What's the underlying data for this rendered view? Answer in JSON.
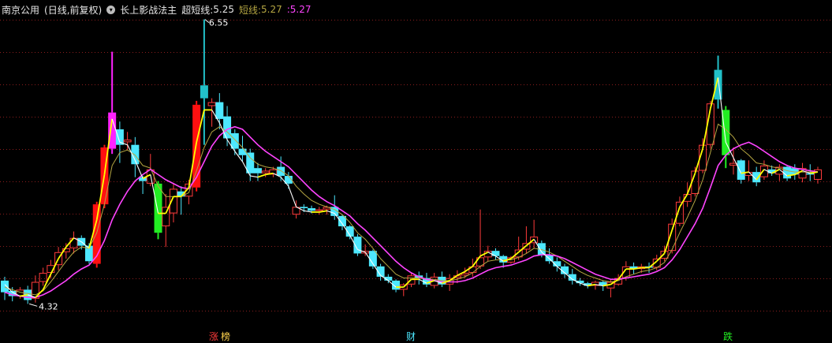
{
  "header": {
    "stock": "南京公用",
    "mode": "(日线,前复权)",
    "indicator_name": "长上影战法主",
    "line1_label": "超短线:",
    "line1_value": "5.25",
    "line2_label": "短线:",
    "line2_value": "5.27",
    "line3_label": ":",
    "line3_value": "5.27",
    "dropdown_icon": "chevron-down-icon"
  },
  "colors": {
    "up": "#ff3b3b",
    "down": "#4de8ff",
    "grid": "#8a1d1d",
    "signal_magenta": "#ff22ff",
    "signal_cyan": "#22c0c8",
    "signal_red": "#ff1010",
    "signal_green": "#22ee22",
    "line_fast": "#ffff00",
    "line_white": "#ffffff",
    "line_olive": "#b5a642",
    "line_ma": "#ff44ff"
  },
  "chart_data": {
    "type": "candlestick",
    "ylim": [
      4.2,
      6.7
    ],
    "annotations": {
      "high_label": "6.55",
      "low_label": "4.32"
    },
    "markers": [
      "涨",
      "榜",
      "财",
      "跌"
    ],
    "candles": [
      [
        4.53,
        4.44,
        4.56,
        4.38
      ],
      [
        4.45,
        4.41,
        4.48,
        4.37
      ],
      [
        4.41,
        4.46,
        4.48,
        4.39
      ],
      [
        4.46,
        4.38,
        4.49,
        4.35
      ],
      [
        4.39,
        4.52,
        4.57,
        4.36
      ],
      [
        4.52,
        4.59,
        4.63,
        4.49
      ],
      [
        4.59,
        4.65,
        4.69,
        4.55
      ],
      [
        4.65,
        4.75,
        4.79,
        4.61
      ],
      [
        4.75,
        4.78,
        4.82,
        4.7
      ],
      [
        4.78,
        4.86,
        4.91,
        4.74
      ],
      [
        4.86,
        4.8,
        4.88,
        4.77
      ],
      [
        4.8,
        4.68,
        4.82,
        4.66
      ],
      [
        4.66,
        5.12,
        5.14,
        4.63
      ],
      [
        5.12,
        5.56,
        5.58,
        5.09
      ],
      [
        5.55,
        5.83,
        6.3,
        5.51
      ],
      [
        5.7,
        5.58,
        5.76,
        5.44
      ],
      [
        5.6,
        5.62,
        5.68,
        5.54
      ],
      [
        5.58,
        5.43,
        5.64,
        5.33
      ],
      [
        5.33,
        5.3,
        5.34,
        5.2
      ],
      [
        5.28,
        5.39,
        5.51,
        5.26
      ],
      [
        5.28,
        4.9,
        5.3,
        4.85
      ],
      [
        4.95,
        5.1,
        5.2,
        4.79
      ],
      [
        5.05,
        5.24,
        5.28,
        4.98
      ],
      [
        5.22,
        5.18,
        5.26,
        5.04
      ],
      [
        5.18,
        5.28,
        5.31,
        5.12
      ],
      [
        5.25,
        5.89,
        5.92,
        5.22
      ],
      [
        6.04,
        5.94,
        6.55,
        5.58
      ],
      [
        5.88,
        5.91,
        5.94,
        5.72
      ],
      [
        5.91,
        5.78,
        5.98,
        5.7
      ],
      [
        5.8,
        5.63,
        5.88,
        5.57
      ],
      [
        5.67,
        5.55,
        5.7,
        5.5
      ],
      [
        5.55,
        5.5,
        5.65,
        5.45
      ],
      [
        5.52,
        5.36,
        5.55,
        5.3
      ],
      [
        5.4,
        5.36,
        5.44,
        5.3
      ],
      [
        5.36,
        5.38,
        5.4,
        5.33
      ],
      [
        5.35,
        5.39,
        5.41,
        5.33
      ],
      [
        5.41,
        5.34,
        5.49,
        5.3
      ],
      [
        5.34,
        5.28,
        5.37,
        5.24
      ],
      [
        5.04,
        5.1,
        5.15,
        5.01
      ],
      [
        5.1,
        5.09,
        5.12,
        5.06
      ],
      [
        5.09,
        5.07,
        5.11,
        5.05
      ],
      [
        5.07,
        5.08,
        5.1,
        5.04
      ],
      [
        5.08,
        5.1,
        5.11,
        5.04
      ],
      [
        5.1,
        5.03,
        5.19,
        5.0
      ],
      [
        5.03,
        4.95,
        5.04,
        4.92
      ],
      [
        4.95,
        4.87,
        4.96,
        4.85
      ],
      [
        4.87,
        4.74,
        4.89,
        4.72
      ],
      [
        4.74,
        4.76,
        4.81,
        4.72
      ],
      [
        4.76,
        4.64,
        4.77,
        4.62
      ],
      [
        4.64,
        4.56,
        4.66,
        4.53
      ],
      [
        4.56,
        4.53,
        4.58,
        4.51
      ],
      [
        4.53,
        4.46,
        4.54,
        4.44
      ],
      [
        4.46,
        4.5,
        4.51,
        4.41
      ],
      [
        4.5,
        4.57,
        4.59,
        4.48
      ],
      [
        4.57,
        4.55,
        4.6,
        4.5
      ],
      [
        4.55,
        4.5,
        4.59,
        4.48
      ],
      [
        4.49,
        4.56,
        4.59,
        4.47
      ],
      [
        4.56,
        4.5,
        4.6,
        4.48
      ],
      [
        4.5,
        4.55,
        4.58,
        4.45
      ],
      [
        4.55,
        4.57,
        4.61,
        4.51
      ],
      [
        4.57,
        4.59,
        4.63,
        4.55
      ],
      [
        4.59,
        4.64,
        4.7,
        4.56
      ],
      [
        4.64,
        4.71,
        5.08,
        4.62
      ],
      [
        4.71,
        4.76,
        4.8,
        4.68
      ],
      [
        4.76,
        4.72,
        4.78,
        4.69
      ],
      [
        4.72,
        4.67,
        4.73,
        4.63
      ],
      [
        4.67,
        4.71,
        4.72,
        4.66
      ],
      [
        4.71,
        4.77,
        4.87,
        4.69
      ],
      [
        4.77,
        4.82,
        4.95,
        4.74
      ],
      [
        4.82,
        4.87,
        5.0,
        4.78
      ],
      [
        4.82,
        4.73,
        4.84,
        4.71
      ],
      [
        4.73,
        4.68,
        4.78,
        4.66
      ],
      [
        4.68,
        4.64,
        4.71,
        4.6
      ],
      [
        4.64,
        4.58,
        4.66,
        4.55
      ],
      [
        4.58,
        4.53,
        4.62,
        4.5
      ],
      [
        4.53,
        4.51,
        4.55,
        4.49
      ],
      [
        4.51,
        4.49,
        4.52,
        4.47
      ],
      [
        4.49,
        4.52,
        4.53,
        4.46
      ],
      [
        4.52,
        4.49,
        4.53,
        4.45
      ],
      [
        4.47,
        4.52,
        4.54,
        4.4
      ],
      [
        4.5,
        4.55,
        4.58,
        4.49
      ],
      [
        4.55,
        4.64,
        4.68,
        4.53
      ],
      [
        4.64,
        4.62,
        4.67,
        4.58
      ],
      [
        4.62,
        4.64,
        4.66,
        4.59
      ],
      [
        4.64,
        4.63,
        4.67,
        4.59
      ],
      [
        4.63,
        4.7,
        4.73,
        4.61
      ],
      [
        4.7,
        4.76,
        4.8,
        4.68
      ],
      [
        4.76,
        4.97,
        5.01,
        4.74
      ],
      [
        4.97,
        5.14,
        5.18,
        4.95
      ],
      [
        5.14,
        5.2,
        5.29,
        5.1
      ],
      [
        5.2,
        5.38,
        5.41,
        5.18
      ],
      [
        5.38,
        5.58,
        5.63,
        5.36
      ],
      [
        5.58,
        5.9,
        5.92,
        5.55
      ],
      [
        5.93,
        6.16,
        6.27,
        5.86
      ],
      [
        5.85,
        5.5,
        5.88,
        5.4
      ],
      [
        5.42,
        5.44,
        5.56,
        5.35
      ],
      [
        5.46,
        5.31,
        5.47,
        5.28
      ],
      [
        5.34,
        5.37,
        5.46,
        5.3
      ],
      [
        5.37,
        5.29,
        5.41,
        5.26
      ],
      [
        5.33,
        5.42,
        5.46,
        5.31
      ],
      [
        5.39,
        5.36,
        5.42,
        5.34
      ],
      [
        5.35,
        5.41,
        5.43,
        5.3
      ],
      [
        5.41,
        5.32,
        5.42,
        5.3
      ],
      [
        5.4,
        5.35,
        5.43,
        5.31
      ],
      [
        5.32,
        5.4,
        5.44,
        5.29
      ],
      [
        5.36,
        5.35,
        5.43,
        5.3
      ],
      [
        5.31,
        5.39,
        5.41,
        5.28
      ]
    ],
    "series": [
      {
        "key": "fast",
        "values": [
          4.5,
          4.44,
          4.41,
          4.42,
          4.4,
          4.46,
          4.58,
          4.7,
          4.79,
          4.86,
          4.83,
          4.78,
          5.0,
          5.35,
          5.78,
          5.6,
          5.58,
          5.46,
          5.32,
          5.35,
          5.05,
          5.05,
          5.18,
          5.18,
          5.25,
          5.6,
          5.85,
          5.85,
          5.75,
          5.62,
          5.53,
          5.45,
          5.34,
          5.33,
          5.35,
          5.36,
          5.33,
          5.26,
          5.1,
          5.07,
          5.06,
          5.06,
          5.07,
          5.05,
          4.97,
          4.88,
          4.77,
          4.75,
          4.66,
          4.57,
          4.53,
          4.48,
          4.48,
          4.54,
          4.54,
          4.51,
          4.53,
          4.51,
          4.53,
          4.57,
          4.6,
          4.64,
          4.72,
          4.75,
          4.72,
          4.68,
          4.7,
          4.75,
          4.8,
          4.85,
          4.75,
          4.7,
          4.64,
          4.59,
          4.54,
          4.51,
          4.49,
          4.5,
          4.49,
          4.5,
          4.54,
          4.62,
          4.62,
          4.63,
          4.63,
          4.68,
          4.74,
          4.92,
          5.1,
          5.2,
          5.36,
          5.55,
          5.86,
          6.1,
          5.6,
          5.48,
          5.36,
          5.37,
          5.31,
          5.39,
          5.36,
          5.39,
          5.34,
          5.35,
          5.38,
          5.36,
          5.37
        ]
      },
      {
        "key": "mid",
        "values": [
          4.48,
          4.46,
          4.44,
          4.43,
          4.42,
          4.45,
          4.52,
          4.6,
          4.68,
          4.75,
          4.79,
          4.78,
          4.9,
          5.12,
          5.42,
          5.52,
          5.54,
          5.5,
          5.42,
          5.4,
          5.26,
          5.18,
          5.18,
          5.18,
          5.21,
          5.38,
          5.56,
          5.68,
          5.72,
          5.68,
          5.62,
          5.56,
          5.48,
          5.43,
          5.41,
          5.4,
          5.38,
          5.34,
          5.26,
          5.2,
          5.15,
          5.12,
          5.1,
          5.08,
          5.04,
          4.98,
          4.9,
          4.85,
          4.78,
          4.7,
          4.64,
          4.58,
          4.55,
          4.55,
          4.55,
          4.54,
          4.54,
          4.53,
          4.53,
          4.54,
          4.56,
          4.59,
          4.64,
          4.68,
          4.69,
          4.69,
          4.69,
          4.71,
          4.74,
          4.78,
          4.77,
          4.75,
          4.72,
          4.68,
          4.64,
          4.6,
          4.57,
          4.55,
          4.53,
          4.52,
          4.53,
          4.56,
          4.58,
          4.6,
          4.61,
          4.63,
          4.67,
          4.77,
          4.9,
          5.02,
          5.15,
          5.31,
          5.52,
          5.74,
          5.7,
          5.64,
          5.55,
          5.5,
          5.44,
          5.43,
          5.41,
          5.4,
          5.38,
          5.37,
          5.37,
          5.37,
          5.37
        ]
      },
      {
        "key": "ma",
        "values": [
          4.44,
          4.42,
          4.41,
          4.4,
          4.4,
          4.42,
          4.45,
          4.49,
          4.53,
          4.58,
          4.62,
          4.65,
          4.72,
          4.84,
          5.0,
          5.12,
          5.22,
          5.3,
          5.35,
          5.39,
          5.35,
          5.31,
          5.28,
          5.25,
          5.24,
          5.33,
          5.45,
          5.57,
          5.65,
          5.7,
          5.72,
          5.7,
          5.64,
          5.58,
          5.53,
          5.49,
          5.45,
          5.41,
          5.35,
          5.29,
          5.23,
          5.18,
          5.14,
          5.11,
          5.07,
          5.03,
          4.97,
          4.92,
          4.86,
          4.8,
          4.74,
          4.68,
          4.63,
          4.59,
          4.56,
          4.54,
          4.53,
          4.52,
          4.52,
          4.52,
          4.53,
          4.55,
          4.58,
          4.61,
          4.63,
          4.64,
          4.65,
          4.67,
          4.69,
          4.72,
          4.73,
          4.73,
          4.72,
          4.7,
          4.67,
          4.64,
          4.61,
          4.58,
          4.56,
          4.54,
          4.54,
          4.55,
          4.56,
          4.57,
          4.58,
          4.6,
          4.63,
          4.69,
          4.77,
          4.87,
          4.97,
          5.09,
          5.25,
          5.42,
          5.5,
          5.55,
          5.58,
          5.6,
          5.57,
          5.53,
          5.49,
          5.45,
          5.42,
          5.4,
          5.39,
          5.38,
          5.37
        ]
      }
    ]
  }
}
